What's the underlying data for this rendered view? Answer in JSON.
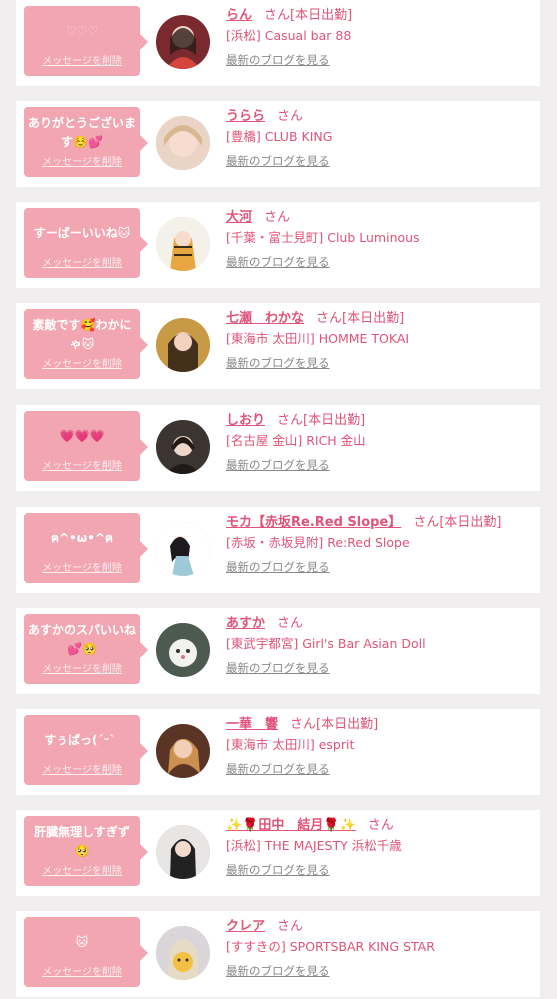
{
  "delete_label": "メッセージを削除",
  "san_label": "さん",
  "blog_label": "最新のブログを見る",
  "colors": {
    "bubble": "#f2a6b2",
    "accent": "#e0537a",
    "background": "#f0eeee"
  },
  "cards": [
    {
      "message": "♡♡♡",
      "name": "らん",
      "status": "[本日出勤]",
      "shop": "[浜松] Casual bar 88"
    },
    {
      "message": "ありがとうございます☺️💕",
      "name": "うらら",
      "status": "",
      "shop": "[豊橋] CLUB KING"
    },
    {
      "message": "すーばーいいね🐱",
      "name": "大河",
      "status": "",
      "shop": "[千葉・富士見町] Club Luminous"
    },
    {
      "message": "素敵です🥰わかにゃ🐱",
      "name": "七瀬　わかな",
      "status": "[本日出勤]",
      "shop": "[東海市 太田川] HOMME TOKAI"
    },
    {
      "message": "💗💗💗",
      "name": "しおり",
      "status": "[本日出勤]",
      "shop": "[名古屋 金山] RICH 金山"
    },
    {
      "message": "ฅ^•ω•^ฅ",
      "name": "モカ【赤坂Re.Red Slope】",
      "status": "[本日出勤]",
      "shop": "[赤坂・赤坂見附] Re:Red Slope"
    },
    {
      "message": "あすかのスパいいね💕🥺",
      "name": "あすか",
      "status": "",
      "shop": "[東武宇都宮] Girl's Bar Asian Doll"
    },
    {
      "message": "すぅぱっ(ˊᵕˋ ‪‪",
      "name": "一華　響",
      "status": "[本日出勤]",
      "shop": "[東海市 太田川] esprit"
    },
    {
      "message": "肝臓無理しすぎず🥺",
      "name": "✨🌹田中　結月🌹✨",
      "status": "",
      "shop": "[浜松] THE MAJESTY 浜松千歳"
    },
    {
      "message": "🐱",
      "name": "クレア",
      "status": "",
      "shop": "[すすきの] SPORTSBAR KING STAR"
    }
  ]
}
